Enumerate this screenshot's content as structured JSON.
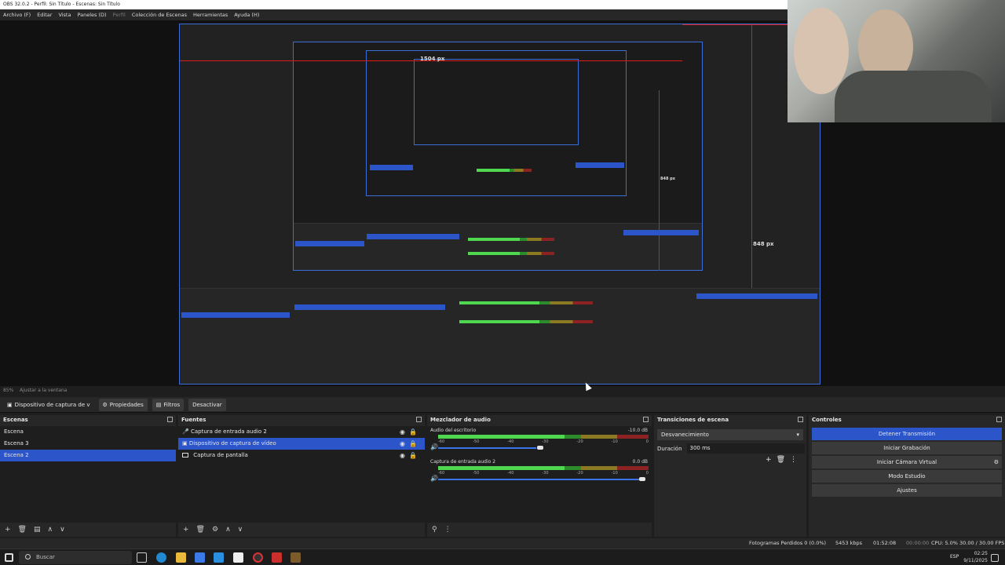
{
  "window": {
    "title": "OBS 32.0.2 - Perfil: Sin Título - Escenas: Sin Título"
  },
  "menu": [
    "Archivo (F)",
    "Editar",
    "Vista",
    "Paneles (D)",
    "Perfil",
    "Colección de Escenas",
    "Herramientas",
    "Ayuda (H)"
  ],
  "preview": {
    "measure_1": "1504 px",
    "measure_2": "848 px",
    "measure_3": "848 px"
  },
  "zoom": {
    "value": "85%",
    "fit_label": "Ajustar a la ventana"
  },
  "source_toolbar": {
    "selected_source": "Dispositivo de captura de v",
    "properties": "Propiedades",
    "filters": "Filtros",
    "deactivate": "Desactivar"
  },
  "scenes": {
    "title": "Escenas",
    "items": [
      {
        "label": "Escena",
        "selected": false
      },
      {
        "label": "Escena 3",
        "selected": false
      },
      {
        "label": "Escena 2",
        "selected": true
      }
    ]
  },
  "sources": {
    "title": "Fuentes",
    "items": [
      {
        "label": "Captura de entrada audio 2",
        "icon": "mic-icon",
        "selected": false
      },
      {
        "label": "Dispositivo de captura de vídeo",
        "icon": "camera-icon",
        "selected": true
      },
      {
        "label": "Captura de pantalla",
        "icon": "monitor-icon",
        "selected": false
      }
    ]
  },
  "mixer": {
    "title": "Mezclador de audio",
    "channels": [
      {
        "name": "Audio del escritorio",
        "db": "-10.0 dB",
        "level": 0.52,
        "volume": 0.8
      },
      {
        "name": "Captura de entrada audio 2",
        "db": "0.0 dB",
        "level": 0.33,
        "volume": 1.0
      }
    ],
    "ticks": [
      "-60",
      "-55",
      "-50",
      "-45",
      "-40",
      "-35",
      "-30",
      "-25",
      "-20",
      "-15",
      "-10",
      "-5",
      "0"
    ]
  },
  "transitions": {
    "title": "Transiciones de escena",
    "selected": "Desvanecimiento",
    "duration_label": "Duración",
    "duration_value": "300 ms"
  },
  "controls": {
    "title": "Controles",
    "stop_stream": "Detener Transmisión",
    "start_recording": "Iniciar Grabación",
    "start_virtual_cam": "Iniciar Cámara Virtual",
    "studio_mode": "Modo Estudio",
    "settings": "Ajustes"
  },
  "status": {
    "dropped_frames": "Fotogramas Perdidos 0 (0.0%)",
    "bitrate": "5453 kbps",
    "stream_time": "01:52:08",
    "rec_time": "00:00:00",
    "cpu": "CPU: 5.0%",
    "fps": "30.00 / 30.00 FPS"
  },
  "taskbar": {
    "search_placeholder": "Buscar",
    "lang": "ESP",
    "time": "02:25",
    "date": "9/11/2025"
  }
}
